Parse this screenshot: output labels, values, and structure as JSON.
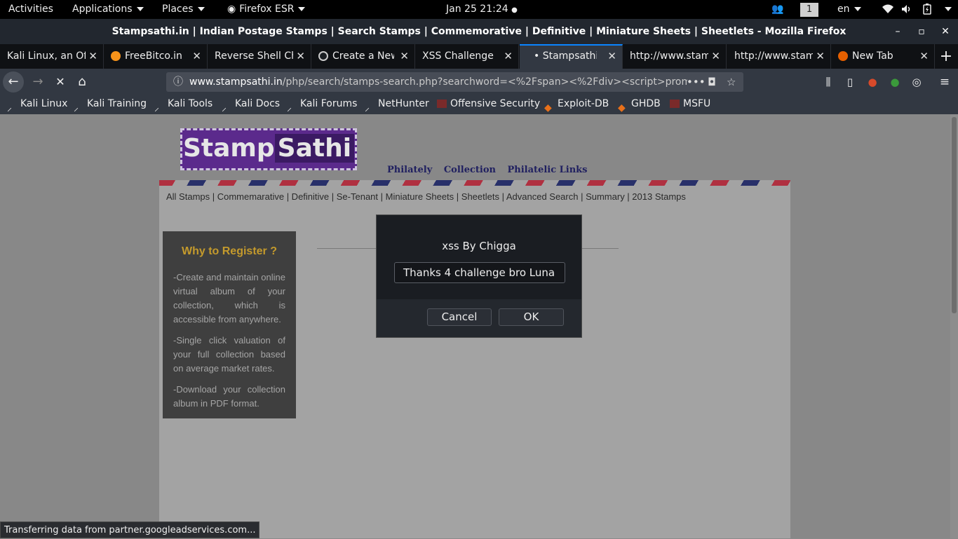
{
  "topbar": {
    "activities": "Activities",
    "applications": "Applications",
    "places": "Places",
    "firefox": "Firefox ESR",
    "clock": "Jan 25  21:24",
    "workspace": "1",
    "lang": "en"
  },
  "window": {
    "title": "Stampsathi.in | Indian Postage Stamps | Search Stamps | Commemorative | Definitive | Miniature Sheets | Sheetlets - Mozilla Firefox",
    "minimize": "–",
    "maximize": "▫",
    "close": "✕"
  },
  "tabs": [
    {
      "label": "Kali Linux, an Off"
    },
    {
      "label": "FreeBitco.in"
    },
    {
      "label": "Reverse Shell Ch"
    },
    {
      "label": "Create a New"
    },
    {
      "label": "XSS Challenge"
    },
    {
      "label": "• Stampsathi.in"
    },
    {
      "label": "http://www.stam"
    },
    {
      "label": "http://www.stam"
    },
    {
      "label": "New Tab"
    }
  ],
  "nav": {
    "url_host": "www.stampsathi.in",
    "url_path": "/php/search/stamps-search.php?searchword=<%2Fspan><%2Fdiv><script>prom",
    "colors": {
      "accent": "#0a84ff"
    }
  },
  "bookmarks": [
    {
      "label": "Kali Linux"
    },
    {
      "label": "Kali Training"
    },
    {
      "label": "Kali Tools"
    },
    {
      "label": "Kali Docs"
    },
    {
      "label": "Kali Forums"
    },
    {
      "label": "NetHunter"
    },
    {
      "label": "Offensive Security"
    },
    {
      "label": "Exploit-DB"
    },
    {
      "label": "GHDB"
    },
    {
      "label": "MSFU"
    }
  ],
  "site": {
    "logo_stamp": "Stamp",
    "logo_sathi": "Sathi",
    "topnav": [
      "Philately",
      "Collection",
      "Philatelic Links"
    ],
    "menu": "All Stamps | Commemarative | Definitive | Se-Tenant | Miniature Sheets | Sheetlets | Advanced Search | Summary | 2013 Stamps",
    "sidebox": {
      "title": "Why to Register ?",
      "points": [
        "-Create and maintain online virtual album of your collection, which is accessible from anywhere.",
        "-Single click valuation of your full collection based on average market rates.",
        "-Download your collection album in PDF format."
      ]
    }
  },
  "dialog": {
    "message": "xss By Chigga",
    "input_value": "Thanks 4 challenge bro Luna",
    "cancel": "Cancel",
    "ok": "OK"
  },
  "status": "Transferring data from partner.googleadservices.com..."
}
